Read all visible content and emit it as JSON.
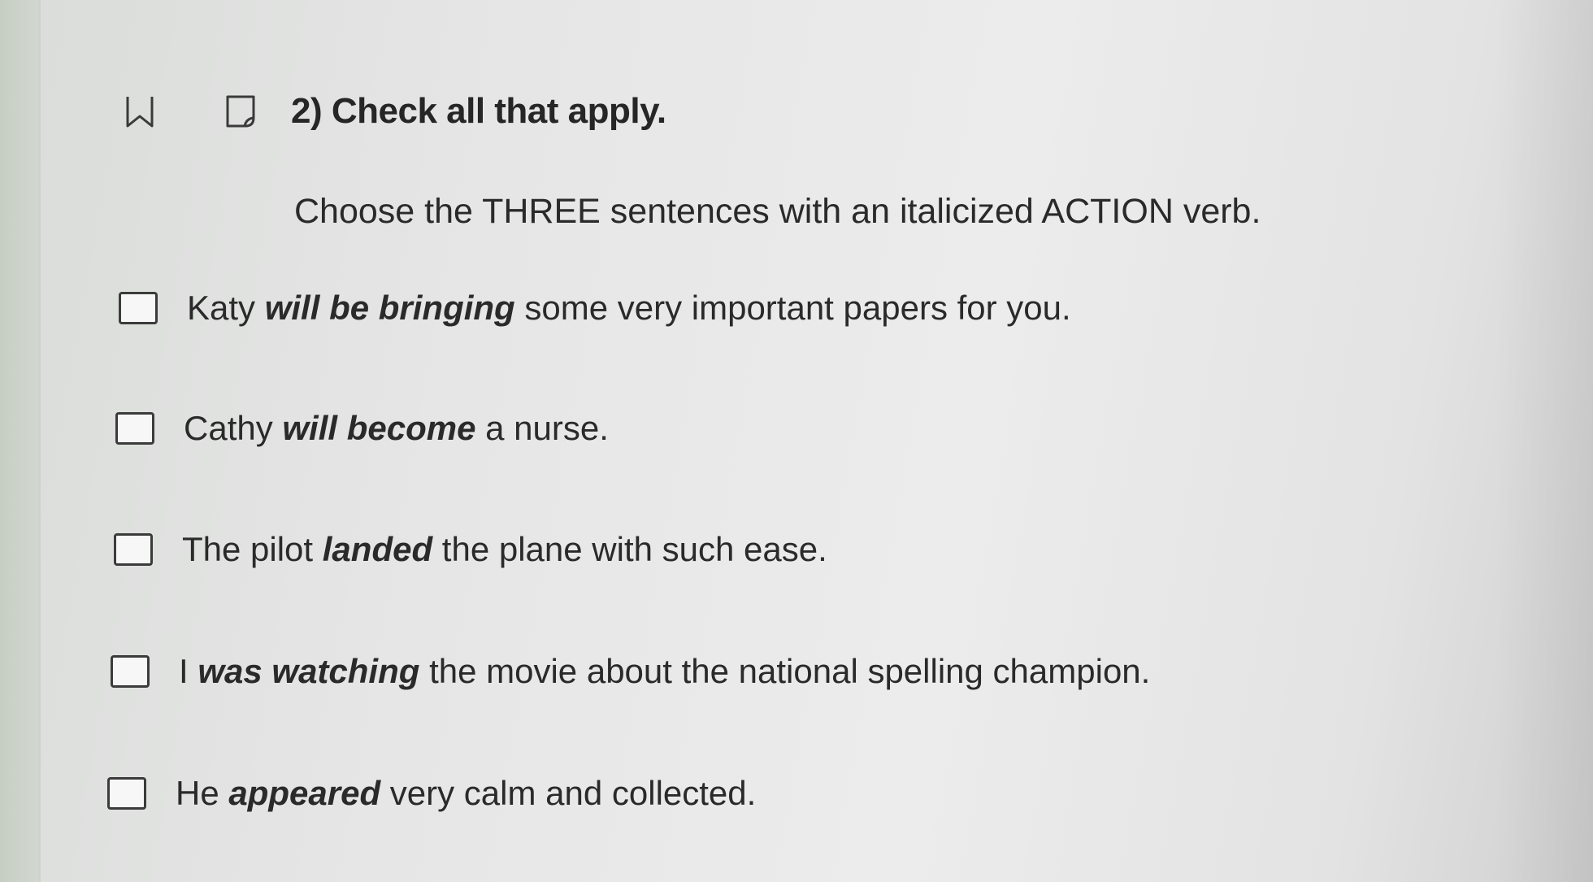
{
  "question": {
    "title": "2) Check all that apply.",
    "instruction": "Choose the THREE sentences with an italicized ACTION verb.",
    "icons": [
      "bookmark-icon",
      "flag-icon"
    ]
  },
  "options": [
    {
      "before": "Katy ",
      "emphasis": "will be bringing",
      "after": " some very important papers for you.",
      "checked": false
    },
    {
      "before": "Cathy ",
      "emphasis": "will become",
      "after": " a nurse.",
      "checked": false
    },
    {
      "before": "The pilot ",
      "emphasis": "landed",
      "after": " the plane with such ease.",
      "checked": false
    },
    {
      "before": "I ",
      "emphasis": "was watching",
      "after": " the movie about the national spelling champion.",
      "checked": false
    },
    {
      "before": "He ",
      "emphasis": "appeared",
      "after": " very calm and collected.",
      "checked": false
    }
  ]
}
